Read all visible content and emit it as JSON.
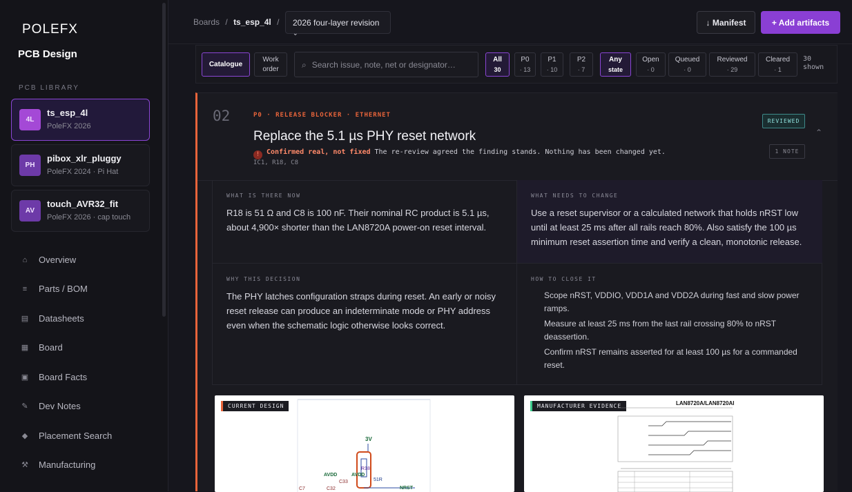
{
  "app": {
    "logo_text": "POLEFX",
    "title": "PCB Design"
  },
  "sidebar": {
    "section_label": "PCB LIBRARY",
    "boards": [
      {
        "badge": "4L",
        "name": "ts_esp_4l",
        "sub": "PoleFX 2026"
      },
      {
        "badge": "PH",
        "name": "pibox_xlr_pluggy",
        "sub": "PoleFX 2024 · Pi Hat"
      },
      {
        "badge": "AV",
        "name": "touch_AVR32_fit",
        "sub": "PoleFX 2026 · cap touch"
      }
    ],
    "nav": [
      {
        "label": "Overview",
        "icon": "home-icon"
      },
      {
        "label": "Parts / BOM",
        "icon": "list-icon"
      },
      {
        "label": "Datasheets",
        "icon": "document-icon"
      },
      {
        "label": "Board",
        "icon": "board-icon"
      },
      {
        "label": "Board Facts",
        "icon": "facts-icon"
      },
      {
        "label": "Dev Notes",
        "icon": "pencil-icon"
      },
      {
        "label": "Placement Search",
        "icon": "diamond-icon"
      },
      {
        "label": "Manufacturing",
        "icon": "tools-icon"
      }
    ]
  },
  "topbar": {
    "crumb_root": "Boards",
    "crumb_sep": "/",
    "crumb_board": "ts_esp_4l",
    "revision": "2026 four-layer revision",
    "manifest_label": "↓ Manifest",
    "add_label": "+ Add artifacts"
  },
  "filters": {
    "view_catalogue": "Catalogue",
    "view_workorder_1": "Work",
    "view_workorder_2": "order",
    "search_placeholder": "Search issue, note, net or designator…",
    "priority": [
      {
        "label": "All",
        "count": "30"
      },
      {
        "label": "P0",
        "count": "· 13"
      },
      {
        "label": "P1",
        "count": "· 10"
      },
      {
        "label": "P2",
        "count": "· 7"
      }
    ],
    "state": [
      {
        "label": "Any",
        "count": "state"
      },
      {
        "label": "Open",
        "count": "· 0"
      },
      {
        "label": "Queued",
        "count": "· 0"
      },
      {
        "label": "Reviewed",
        "count": "· 29"
      },
      {
        "label": "Cleared",
        "count": "· 1"
      }
    ],
    "shown_1": "30",
    "shown_2": "shown"
  },
  "issue": {
    "number": "02",
    "tagline": "P0 · RELEASE BLOCKER · ETHERNET",
    "title": "Replace the 5.1 µs PHY reset network",
    "status_key": "Confirmed real, not fixed",
    "status_text": "The re-review agreed the finding stands. Nothing has been changed yet.",
    "designators": "IC1, R18, C8",
    "state_chip": "REVIEWED",
    "note_chip": "1 NOTE",
    "now_heading": "WHAT IS THERE NOW",
    "now_text": "R18 is 51 Ω and C8 is 100 nF. Their nominal RC product is 5.1 µs, about 4,900× shorter than the LAN8720A power-on reset interval.",
    "change_heading": "WHAT NEEDS TO CHANGE",
    "change_text": "Use a reset supervisor or a calculated network that holds nRST low until at least 25 ms after all rails reach 80%. Also satisfy the 100 µs minimum reset assertion time and verify a clean, monotonic release.",
    "why_heading": "WHY THIS DECISION",
    "why_text": "The PHY latches configuration straps during reset. An early or noisy reset release can produce an indeterminate mode or PHY address even when the schematic logic otherwise looks correct.",
    "close_heading": "HOW TO CLOSE IT",
    "close_steps": [
      "Scope nRST, VDDIO, VDD1A and VDD2A during fast and slow power ramps.",
      "Measure at least 25 ms from the last rail crossing 80% to nRST deassertion.",
      "Confirm nRST remains asserted for at least 100 µs for a commanded reset."
    ],
    "evidence_left_label": "CURRENT DESIGN",
    "evidence_right_label": "MANUFACTURER EVIDENCE",
    "schematic": {
      "net_3v": "3V",
      "r18": "R18",
      "r_val": "51R",
      "avdd1": "AVDD",
      "avdd2": "AVDD",
      "c33": "C33",
      "c32": "C32",
      "c7": "C7",
      "nrst": "NRST"
    },
    "datasheet": {
      "title": "LAN8720A/LAN8720AI"
    }
  }
}
